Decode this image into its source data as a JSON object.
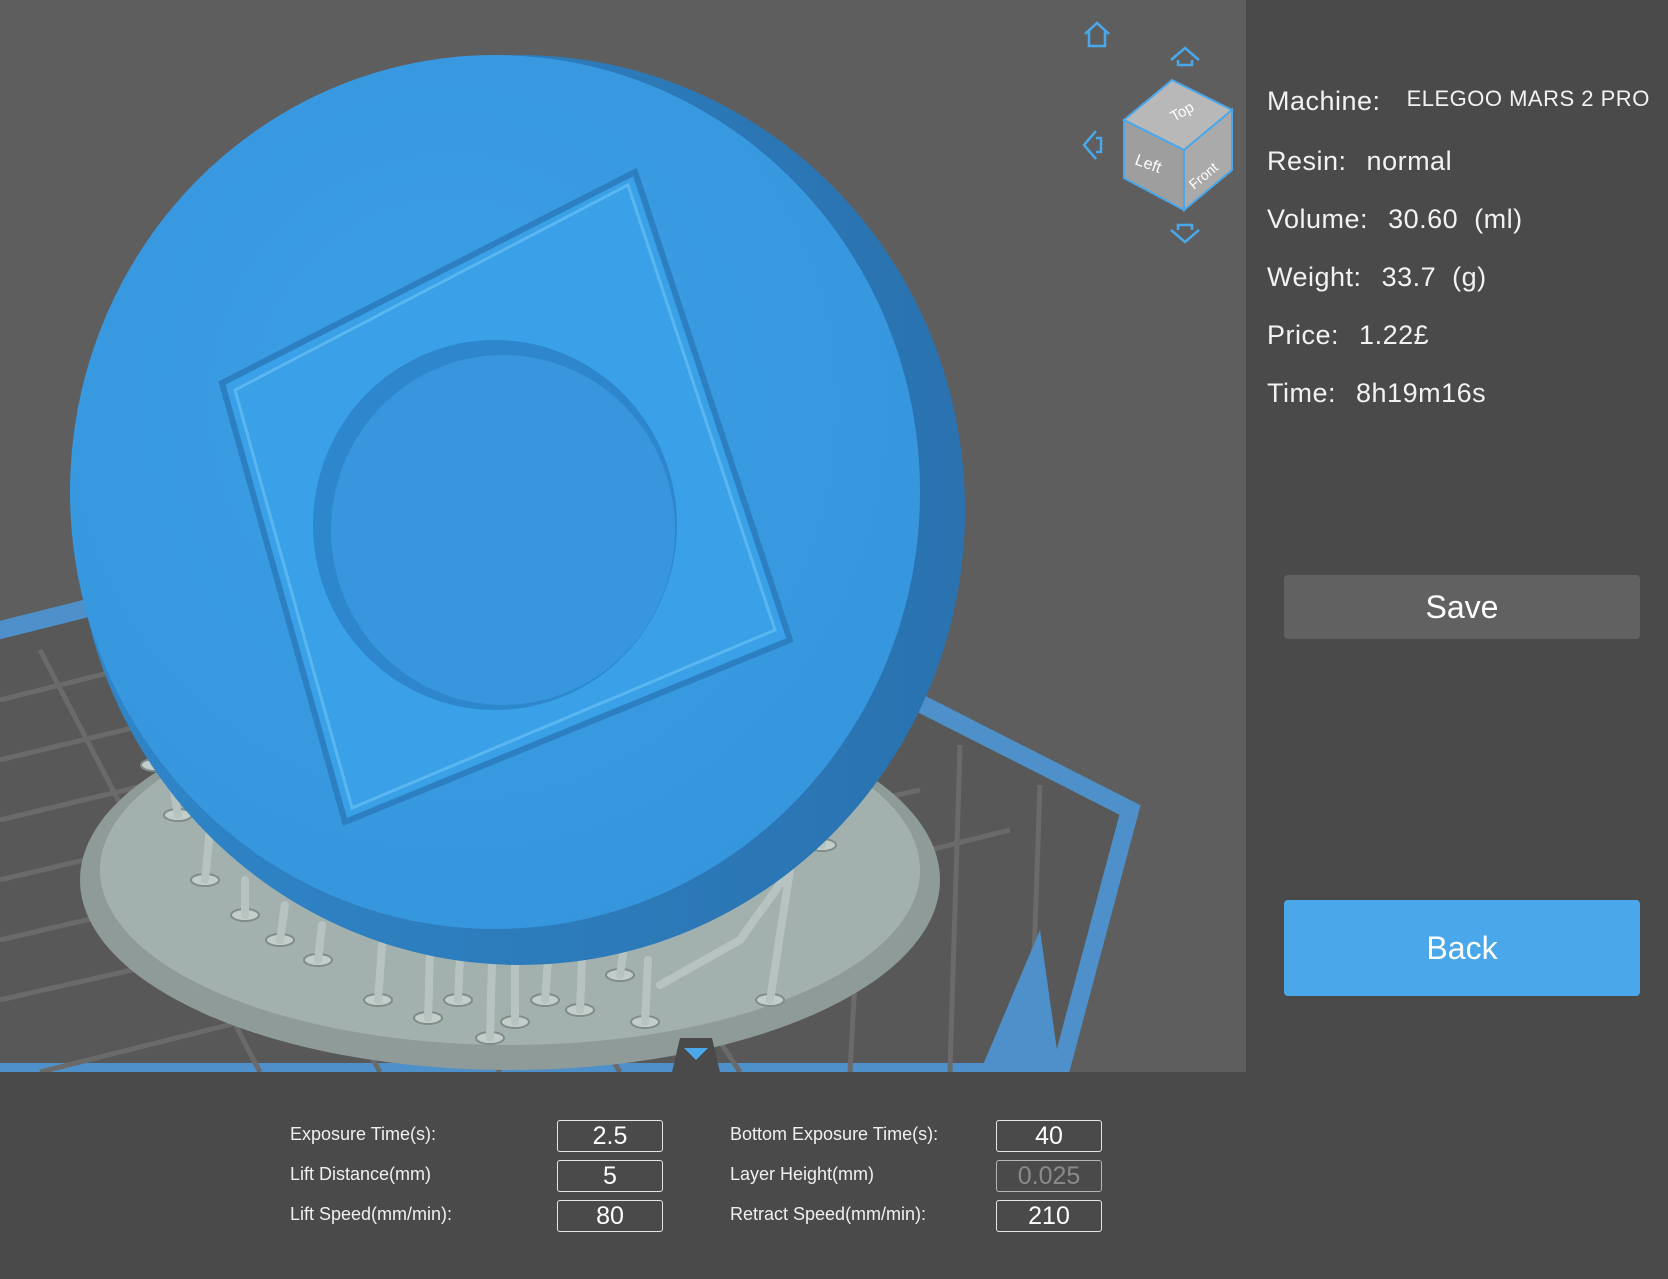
{
  "info": {
    "machine_label": "Machine:",
    "machine_value": "ELEGOO MARS 2 PRO",
    "resin_label": "Resin:",
    "resin_value": "normal",
    "volume_label": "Volume:",
    "volume_value": "30.60  (ml)",
    "weight_label": "Weight:",
    "weight_value": "33.7  (g)",
    "price_label": "Price:",
    "price_value": "1.22£",
    "time_label": "Time:",
    "time_value": "8h19m16s"
  },
  "buttons": {
    "save": "Save",
    "back": "Back"
  },
  "view_cube": {
    "top": "Top",
    "left": "Left",
    "front": "Front"
  },
  "params": {
    "exposure_time_label": "Exposure Time(s):",
    "exposure_time_value": "2.5",
    "bottom_exposure_time_label": "Bottom Exposure Time(s):",
    "bottom_exposure_time_value": "40",
    "lift_distance_label": "Lift Distance(mm)",
    "lift_distance_value": "5",
    "layer_height_label": "Layer Height(mm)",
    "layer_height_value": "0.025",
    "lift_speed_label": "Lift Speed(mm/min):",
    "lift_speed_value": "80",
    "retract_speed_label": "Retract Speed(mm/min):",
    "retract_speed_value": "210"
  },
  "colors": {
    "accent": "#4aa8ea",
    "model": "#3a9be0",
    "supports": "#9aa9a6",
    "plate": "#5b9bd3",
    "viewport_bg": "#5e5e5e",
    "panel_bg": "#4a4a4a"
  },
  "icons": {
    "home": "home-icon",
    "rotate_up": "arrow-up-icon",
    "rotate_down": "arrow-down-icon",
    "rotate_left": "arrow-left-icon",
    "collapse": "chevron-down-icon"
  }
}
